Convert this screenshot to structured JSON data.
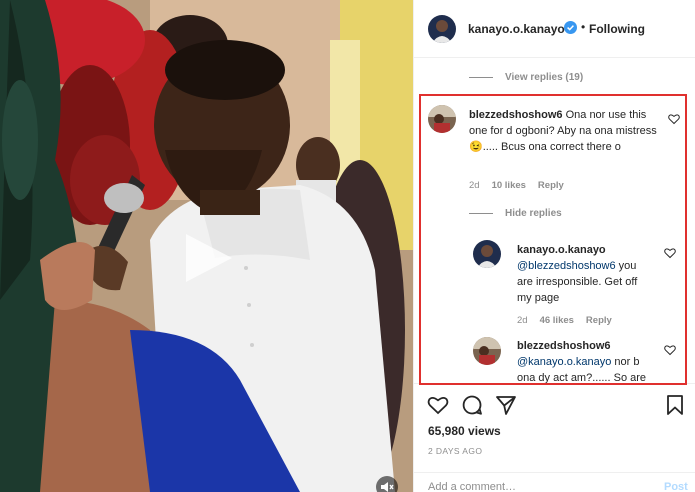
{
  "post": {
    "username": "kanayo.o.kanayo",
    "separator": "•",
    "follow_status": "Following",
    "verified": true
  },
  "thread": {
    "view_replies": "View replies (19)",
    "comment": {
      "username": "blezzedshoshow6",
      "text": "Ona nor use this one for d ogboni? Aby na ona mistress 😉..... Bcus ona correct there o",
      "age": "2d",
      "likes": "10 likes",
      "reply": "Reply"
    },
    "hide_replies": "Hide replies",
    "replies": [
      {
        "username": "kanayo.o.kanayo",
        "mention": "@blezzedshoshow6",
        "text": " you are irresponsible. Get off my page",
        "age": "2d",
        "likes": "46 likes",
        "reply": "Reply"
      },
      {
        "username": "blezzedshoshow6",
        "mention": "@kanayo.o.kanayo",
        "text": " nor b ona dy act am?...... So are"
      }
    ]
  },
  "stats": {
    "views": "65,980 views",
    "date": "2 DAYS AGO"
  },
  "comment_box": {
    "placeholder": "Add a comment…",
    "post_label": "Post"
  },
  "icons": {
    "verified": "verified-badge-icon",
    "like": "heart-icon",
    "comment": "comment-icon",
    "share": "share-icon",
    "save": "bookmark-icon",
    "mute": "speaker-muted-icon",
    "play": "play-icon"
  },
  "colors": {
    "highlight": "#e0302e",
    "verified": "#3897f0",
    "mention": "#00376b",
    "muted_text": "#8e8e8e"
  }
}
